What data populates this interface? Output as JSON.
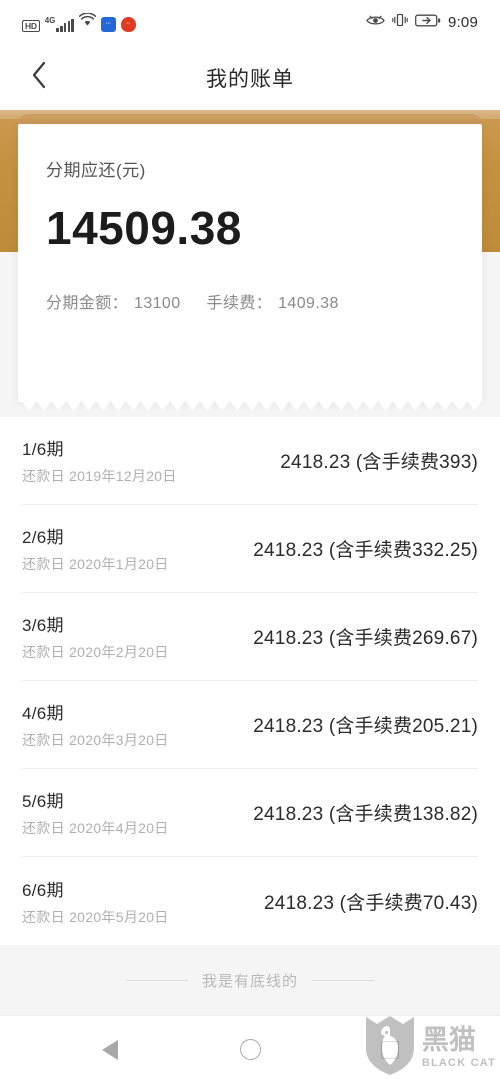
{
  "statusbar": {
    "hd_label": "HD",
    "network_label": "4G",
    "icons": [
      "hd-badge-icon",
      "signal-bars-icon",
      "wifi-icon",
      "app-blue-icon",
      "app-red-icon",
      "eye-icon",
      "vibrate-icon",
      "battery-charging-icon"
    ],
    "time": "9:09"
  },
  "titlebar": {
    "back_icon": "chevron-left-icon",
    "title": "我的账单"
  },
  "summary_card": {
    "label": "分期应还(元)",
    "amount": "14509.38",
    "principal_label": "分期金额：",
    "principal_value": "13100",
    "fee_label": "手续费：",
    "fee_value": "1409.38"
  },
  "installments": [
    {
      "term": "1/6期",
      "date": "还款日 2019年12月20日",
      "amount": "2418.23 (含手续费393)"
    },
    {
      "term": "2/6期",
      "date": "还款日 2020年1月20日",
      "amount": "2418.23 (含手续费332.25)"
    },
    {
      "term": "3/6期",
      "date": "还款日 2020年2月20日",
      "amount": "2418.23 (含手续费269.67)"
    },
    {
      "term": "4/6期",
      "date": "还款日 2020年3月20日",
      "amount": "2418.23 (含手续费205.21)"
    },
    {
      "term": "5/6期",
      "date": "还款日 2020年4月20日",
      "amount": "2418.23 (含手续费138.82)"
    },
    {
      "term": "6/6期",
      "date": "还款日 2020年5月20日",
      "amount": "2418.23 (含手续费70.43)"
    }
  ],
  "footer": {
    "end_text": "我是有底线的"
  },
  "navbar": {
    "back_icon": "nav-back-triangle-icon",
    "home_icon": "nav-home-circle-icon",
    "recents_icon": "nav-recents-square-icon"
  },
  "watermark": {
    "shield_icon": "black-cat-shield-icon",
    "cn": "黑猫",
    "en": "BLACK CAT"
  },
  "colors": {
    "gold_dark": "#bd8b3a",
    "gold_light": "#dbb887",
    "background": "#f5f5f5",
    "text_primary": "#2b2b2b",
    "text_muted": "#b0b0b0"
  }
}
